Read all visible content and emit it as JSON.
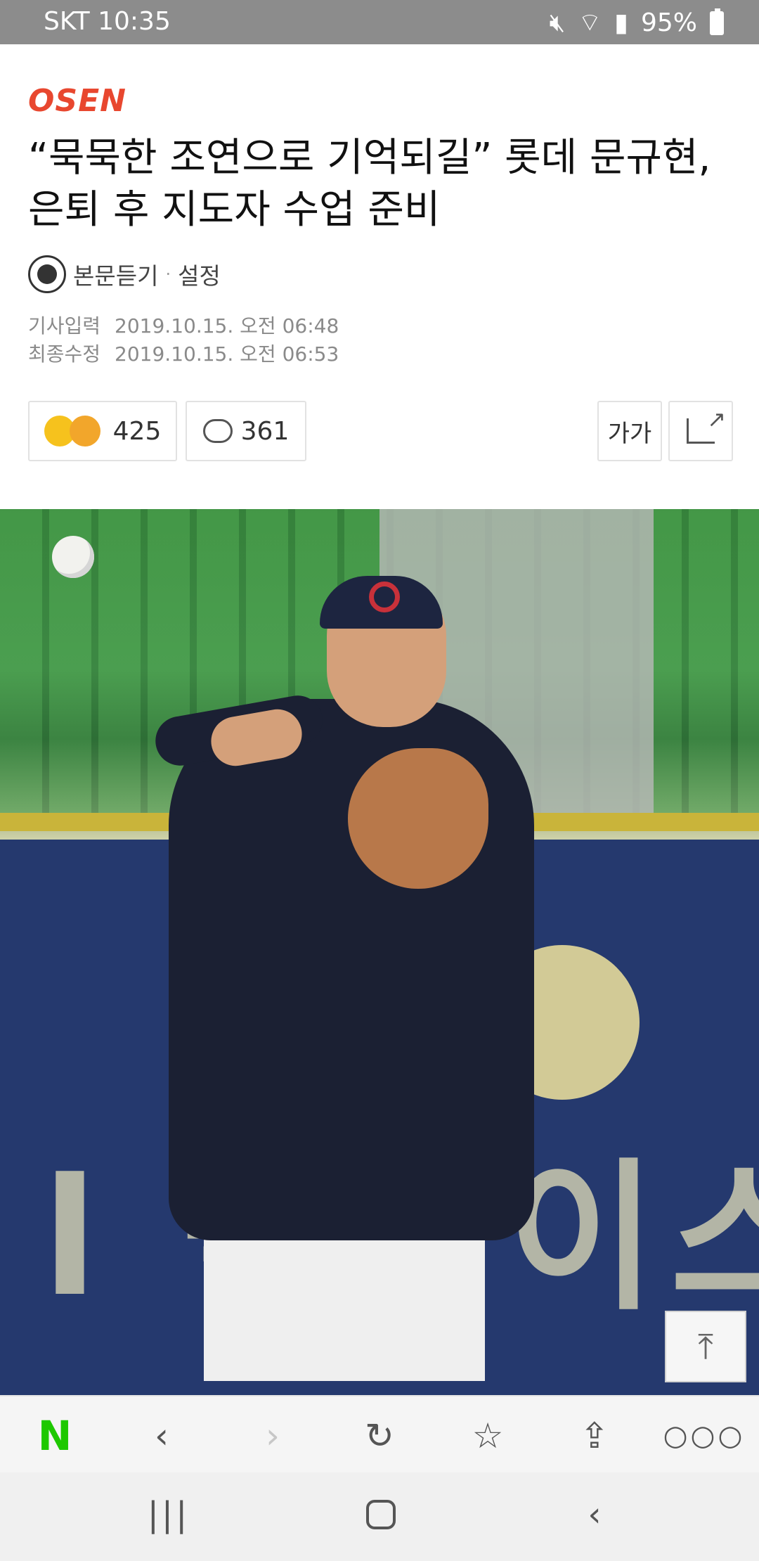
{
  "status_bar": {
    "carrier_time": "SKT 10:35",
    "battery": "95%"
  },
  "article": {
    "publisher": "OSEN",
    "title": "“묵묵한 조연으로 기억되길” 롯데 문규현, 은퇴 후 지도자 수업 준비",
    "listen_label": "본문듣기",
    "separator": "·",
    "settings_label": "설정",
    "input_label": "기사입력",
    "input_time": "2019.10.15. 오전 06:48",
    "modified_label": "최종수정",
    "modified_time": "2019.10.15. 오전 06:53",
    "reaction_count": "425",
    "comment_count": "361",
    "font_size_label": "가가"
  },
  "photo": {
    "banner_text": "l 플러이스"
  },
  "icons": {
    "totop": "arrow-up-icon",
    "back": "chevron-left-icon",
    "forward": "chevron-right-icon",
    "reload": "reload-icon",
    "bookmark": "star-icon",
    "share": "share-icon",
    "more": "more-icon"
  },
  "colors": {
    "brand": "#e8472f",
    "naver_green": "#1ec800"
  }
}
